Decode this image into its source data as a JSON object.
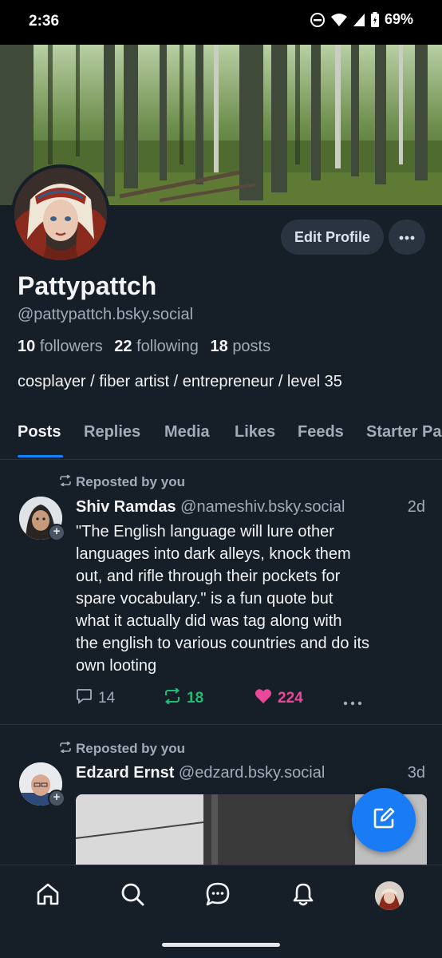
{
  "status_bar": {
    "time": "2:36",
    "battery": "69%"
  },
  "profile": {
    "display_name": "Pattypattch",
    "handle": "@pattypattch.bsky.social",
    "followers_count": "10",
    "followers_label": "followers",
    "following_count": "22",
    "following_label": "following",
    "posts_count": "18",
    "posts_label": "posts",
    "bio": "cosplayer / fiber artist / entrepreneur / level 35",
    "edit_profile_label": "Edit Profile"
  },
  "tabs": [
    {
      "label": "Posts",
      "active": true
    },
    {
      "label": "Replies",
      "active": false
    },
    {
      "label": "Media",
      "active": false
    },
    {
      "label": "Likes",
      "active": false
    },
    {
      "label": "Feeds",
      "active": false
    },
    {
      "label": "Starter Pa",
      "active": false
    }
  ],
  "posts": [
    {
      "repost_label": "Reposted by you",
      "author_name": "Shiv Ramdas",
      "author_handle": "@nameshiv.bsky.social",
      "time": "2d",
      "text_lines": [
        "\"The English language will lure other",
        "languages into dark alleys, knock them",
        "out, and rifle through their pockets for",
        "spare vocabulary.\" is a fun quote but",
        "what it actually did was tag along with",
        "the english to various countries and do its",
        "own looting"
      ],
      "reply_count": "14",
      "repost_count": "18",
      "like_count": "224"
    },
    {
      "repost_label": "Reposted by you",
      "author_name": "Edzard Ernst",
      "author_handle": "@edzard.bsky.social",
      "time": "3d"
    }
  ],
  "colors": {
    "background": "#161e27",
    "accent": "#1083fe",
    "repost_green": "#20bc73",
    "like_pink": "#ec4899",
    "muted_text": "#a2acb8"
  },
  "icons": [
    "dnd-icon",
    "wifi-icon",
    "signal-icon",
    "battery-icon",
    "more-icon",
    "repost-icon",
    "reply-icon",
    "heart-icon",
    "compose-icon",
    "home-icon",
    "search-icon",
    "chat-icon",
    "bell-icon"
  ]
}
